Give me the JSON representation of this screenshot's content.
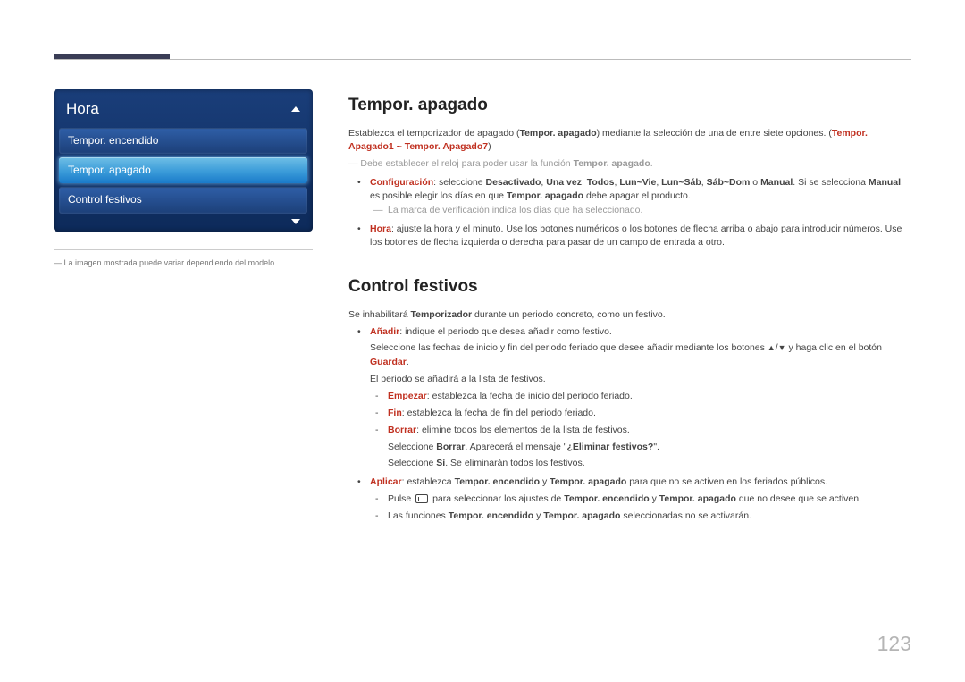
{
  "page_number": "123",
  "menu": {
    "title": "Hora",
    "items": [
      {
        "label": "Tempor. encendido",
        "selected": false
      },
      {
        "label": "Tempor. apagado",
        "selected": true
      },
      {
        "label": "Control festivos",
        "selected": false
      }
    ]
  },
  "left_note": "La imagen mostrada puede variar dependiendo del modelo.",
  "s1": {
    "heading": "Tempor. apagado",
    "intro_a": "Establezca el temporizador de apagado (",
    "intro_b": "Tempor. apagado",
    "intro_c": ") mediante la selección de una de entre siete opciones. (",
    "intro_d": "Tempor. Apagado1",
    "intro_e": " ~ ",
    "intro_f": "Tempor. Apagado7",
    "intro_g": ")",
    "note1_a": "Debe establecer el reloj para poder usar la función ",
    "note1_b": "Tempor. apagado",
    "note1_c": ".",
    "b1_a": "Configuración",
    "b1_b": ": seleccione ",
    "b1_c": "Desactivado",
    "b1_d": ", ",
    "b1_e": "Una vez",
    "b1_f": "Todos",
    "b1_g": "Lun~Vie",
    "b1_h": "Lun~Sáb",
    "b1_i": "Sáb~Dom",
    "b1_j": " o ",
    "b1_k": "Manual",
    "b1_l": ". Si se selecciona ",
    "b1_m": "Manual",
    "b1_n": ", es posible elegir los días en que ",
    "b1_o": "Tempor. apagado",
    "b1_p": " debe apagar el producto.",
    "sub_gray": "La marca de verificación indica los días que ha seleccionado.",
    "b2_a": "Hora",
    "b2_b": ": ajuste la hora y el minuto. Use los botones numéricos o los botones de flecha arriba o abajo para introducir números. Use los botones de flecha izquierda o derecha para pasar de un campo de entrada a otro."
  },
  "s2": {
    "heading": "Control festivos",
    "intro_a": "Se inhabilitará ",
    "intro_b": "Temporizador",
    "intro_c": " durante un periodo concreto, como un festivo.",
    "b1_a": "Añadir",
    "b1_b": ": indique el periodo que desea añadir como festivo.",
    "b1_line2_a": "Seleccione las fechas de inicio y fin del periodo feriado que desee añadir mediante los botones ",
    "b1_line2_b": " y haga clic en el botón ",
    "b1_line2_c": "Guardar",
    "b1_line2_d": ".",
    "b1_line3": "El periodo se añadirá a la lista de festivos.",
    "sub1_a": "Empezar",
    "sub1_b": ": establezca la fecha de inicio del periodo feriado.",
    "sub2_a": "Fin",
    "sub2_b": ": establezca la fecha de fin del periodo feriado.",
    "sub3_a": "Borrar",
    "sub3_b": ": elimine todos los elementos de la lista de festivos.",
    "sub3_line2_a": "Seleccione ",
    "sub3_line2_b": "Borrar",
    "sub3_line2_c": ". Aparecerá el mensaje \"",
    "sub3_line2_d": "¿Eliminar festivos?",
    "sub3_line2_e": "\".",
    "sub3_line3_a": "Seleccione ",
    "sub3_line3_b": "Sí",
    "sub3_line3_c": ". Se eliminarán todos los festivos.",
    "b2_a": "Aplicar",
    "b2_b": ": establezca ",
    "b2_c": "Tempor. encendido",
    "b2_d": " y ",
    "b2_e": "Tempor. apagado",
    "b2_f": " para que no se activen en los feriados públicos.",
    "sub4_a": "Pulse ",
    "sub4_b": " para seleccionar los ajustes de ",
    "sub4_c": "Tempor. encendido",
    "sub4_d": " y ",
    "sub4_e": "Tempor. apagado",
    "sub4_f": " que no desee que se activen.",
    "sub5_a": "Las funciones ",
    "sub5_b": "Tempor. encendido",
    "sub5_c": " y ",
    "sub5_d": "Tempor. apagado",
    "sub5_e": " seleccionadas no se activarán."
  }
}
